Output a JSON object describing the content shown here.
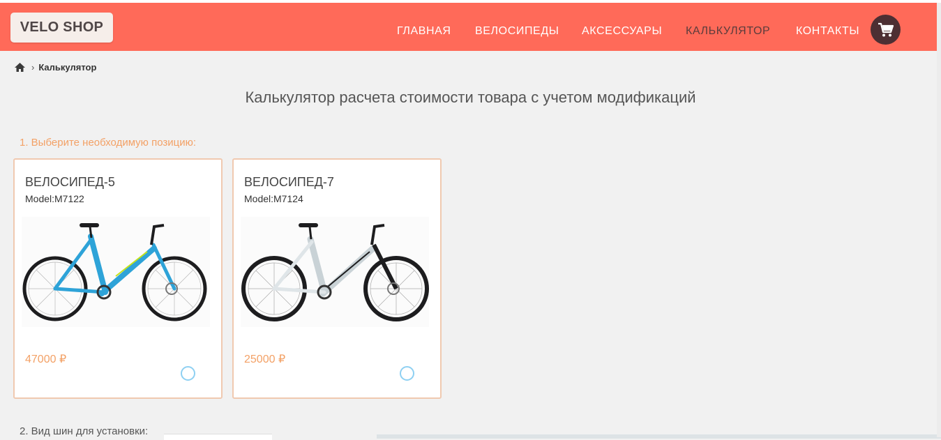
{
  "brand": {
    "logo": "VELO SHOP"
  },
  "nav": {
    "items": [
      {
        "label": "ГЛАВНАЯ"
      },
      {
        "label": "ВЕЛОСИПЕДЫ"
      },
      {
        "label": "АКСЕССУАРЫ"
      },
      {
        "label": "КАЛЬКУЛЯТОР",
        "active": true
      },
      {
        "label": "КОНТАКТЫ"
      }
    ],
    "cart_icon": "shopping-cart-icon"
  },
  "breadcrumb": {
    "home_icon": "home-icon",
    "separator": "›",
    "current": "Калькулятор"
  },
  "page": {
    "title": "Калькулятор расчета стоимости товара с учетом модификаций",
    "step1": "1. Выберите необходимую позицию:",
    "step2": "2. Вид шин для установки:"
  },
  "products": [
    {
      "title": "ВЕЛОСИПЕД-5",
      "model": "Model:M7122",
      "price": "47000 ₽",
      "frame_color": "#2ea3d8"
    },
    {
      "title": "ВЕЛОСИПЕД-7",
      "model": "Model:M7124",
      "price": "25000 ₽",
      "frame_color": "#e9eef0"
    }
  ],
  "colors": {
    "header": "#ff6a59",
    "accent": "#f3a166",
    "radio": "#8ed0f2",
    "cart_bg": "#4d2f33"
  }
}
